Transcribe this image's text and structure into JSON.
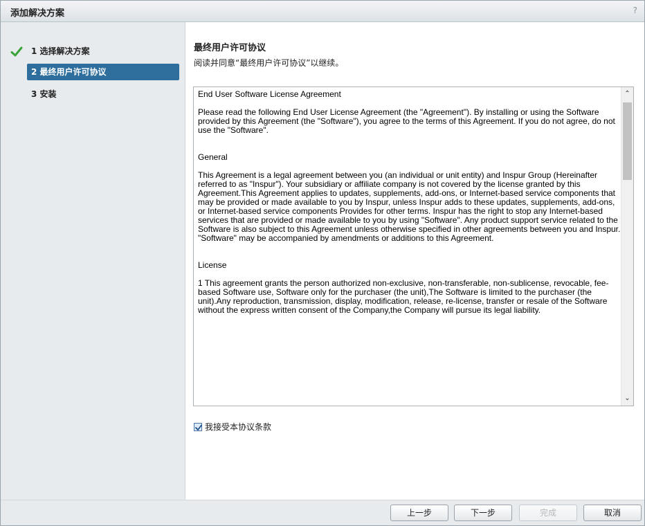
{
  "dialog": {
    "title": "添加解决方案",
    "help_label": "?"
  },
  "sidebar": {
    "steps": [
      {
        "label": "1  选择解决方案",
        "state": "completed"
      },
      {
        "label": "2  最终用户许可协议",
        "state": "active"
      },
      {
        "label": "3  安装",
        "state": "pending"
      }
    ]
  },
  "content": {
    "heading": "最终用户许可协议",
    "subheading": "阅读并同意“最终用户许可协议”以继续。",
    "license": {
      "title": "End User Software License Agreement",
      "intro": "Please read the following End User License Agreement (the \"Agreement\"). By installing or using the Software provided by this Agreement (the \"Software\"), you agree to the terms of this Agreement. If you do not agree, do not use the \"Software\".",
      "section_general": "General",
      "general_text": "This Agreement is a legal agreement between you (an individual or unit entity) and Inspur Group (Hereinafter referred to as \"Inspur\"). Your subsidiary or affiliate company is not covered by the license granted by this Agreement.This Agreement applies to updates, supplements, add-ons, or Internet-based service components that may be provided or made available to you by Inspur, unless Inspur adds to these updates, supplements, add-ons, or Internet-based service components Provides for other terms. Inspur has the right to stop any Internet-based services that are provided or made available to you by using \"Software\". Any product support service related to the Software is also subject to this Agreement unless otherwise specified in other agreements between you and Inspur. \"Software\" may be accompanied by amendments or additions to this Agreement.",
      "section_license": "License",
      "license_text": "1 This agreement grants the person authorized non-exclusive, non-transferable, non-sublicense, revocable, fee-based Software use, Software only for the purchaser (the unit),The Software is limited to the purchaser (the unit).Any reproduction, transmission, display, modification, release, re-license, transfer or resale of the Software without the express written consent of the Company,the Company will pursue its legal liability.",
      "scroll_up_glyph": "⌃",
      "scroll_down_glyph": "⌄"
    },
    "accept_label": "我接受本协议条款",
    "accept_checked": true
  },
  "footer": {
    "back_label": "上一步",
    "next_label": "下一步",
    "finish_label": "完成",
    "cancel_label": "取消"
  },
  "colors": {
    "active_step_bg": "#2d6e9c",
    "check_green": "#3aa33a",
    "sidebar_bg": "#e8ebed"
  }
}
